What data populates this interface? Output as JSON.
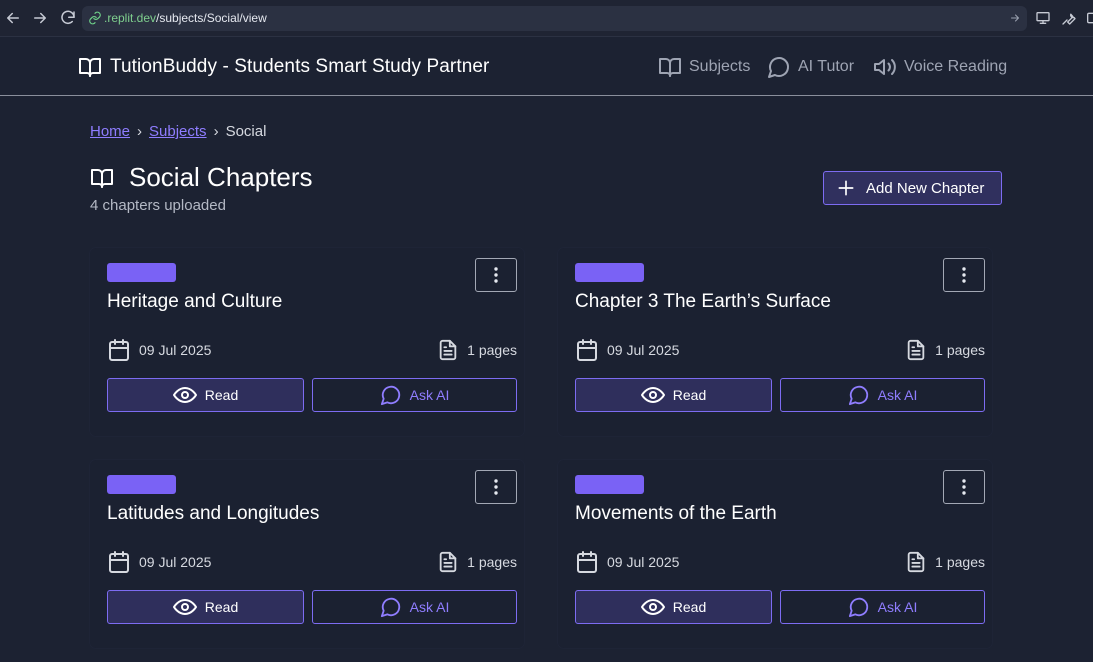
{
  "browser": {
    "url_host": ".replit.dev",
    "url_path": "/subjects/Social/view"
  },
  "header": {
    "brand": "TutionBuddy - Students Smart Study Partner",
    "nav": [
      {
        "label": "Subjects",
        "icon": "book-icon"
      },
      {
        "label": "AI Tutor",
        "icon": "chat-bubble-icon"
      },
      {
        "label": "Voice Reading",
        "icon": "speaker-icon"
      }
    ]
  },
  "breadcrumb": {
    "items": [
      "Home",
      "Subjects"
    ],
    "current": "Social",
    "separator": "›"
  },
  "page": {
    "title": "Social Chapters",
    "subtitle": "4 chapters uploaded",
    "add_button": "Add New Chapter"
  },
  "chapters": [
    {
      "title": "Heritage and Culture",
      "date": "09 Jul 2025",
      "pages": "1 pages",
      "read_label": "Read",
      "ask_label": "Ask AI"
    },
    {
      "title": "Chapter 3 The Earth’s Surface",
      "date": "09 Jul 2025",
      "pages": "1 pages",
      "read_label": "Read",
      "ask_label": "Ask AI"
    },
    {
      "title": "Latitudes and Longitudes",
      "date": "09 Jul 2025",
      "pages": "1 pages",
      "read_label": "Read",
      "ask_label": "Ask AI"
    },
    {
      "title": "Movements of the Earth",
      "date": "09 Jul 2025",
      "pages": "1 pages",
      "read_label": "Read",
      "ask_label": "Ask AI"
    }
  ],
  "colors": {
    "background": "#1c2232",
    "accent": "#7a62f5",
    "link": "#8f7dff"
  }
}
